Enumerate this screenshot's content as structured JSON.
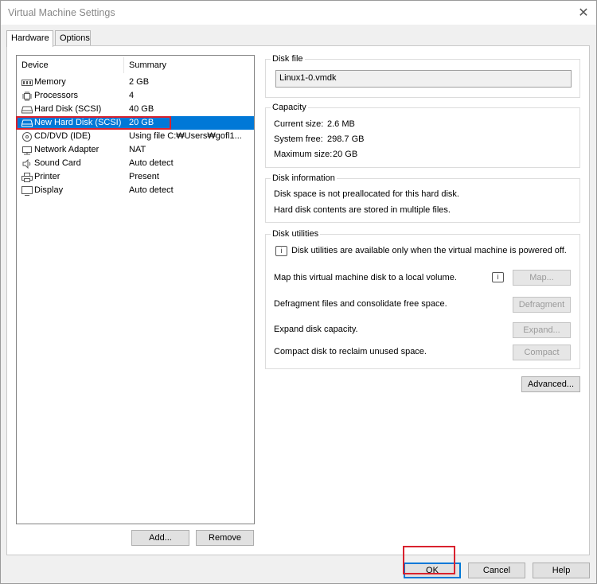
{
  "window": {
    "title": "Virtual Machine Settings",
    "close_glyph": "✕"
  },
  "tabs": [
    {
      "label": "Hardware"
    },
    {
      "label": "Options"
    }
  ],
  "device_list": {
    "col_device": "Device",
    "col_summary": "Summary",
    "rows": [
      {
        "icon": "memory-icon",
        "name": "Memory",
        "summary": "2 GB"
      },
      {
        "icon": "processor-icon",
        "name": "Processors",
        "summary": "4"
      },
      {
        "icon": "hard-disk-icon",
        "name": "Hard Disk (SCSI)",
        "summary": "40 GB"
      },
      {
        "icon": "hard-disk-icon",
        "name": "New Hard Disk (SCSI)",
        "summary": "20 GB",
        "selected": true
      },
      {
        "icon": "cd-dvd-icon",
        "name": "CD/DVD (IDE)",
        "summary": "Using file C:₩Users₩gofl1..."
      },
      {
        "icon": "network-icon",
        "name": "Network Adapter",
        "summary": "NAT"
      },
      {
        "icon": "sound-icon",
        "name": "Sound Card",
        "summary": "Auto detect"
      },
      {
        "icon": "printer-icon",
        "name": "Printer",
        "summary": "Present"
      },
      {
        "icon": "display-icon",
        "name": "Display",
        "summary": "Auto detect"
      }
    ],
    "add_label": "Add...",
    "remove_label": "Remove"
  },
  "disk_file": {
    "label": "Disk file",
    "value": "Linux1-0.vmdk"
  },
  "capacity": {
    "label": "Capacity",
    "current_label": "Current size:",
    "current_value": "2.6 MB",
    "free_label": "System free:",
    "free_value": "298.7 GB",
    "max_label": "Maximum size:",
    "max_value": "20 GB"
  },
  "disk_information": {
    "label": "Disk information",
    "line1": "Disk space is not preallocated for this hard disk.",
    "line2": "Hard disk contents are stored in multiple files."
  },
  "disk_utilities": {
    "label": "Disk utilities",
    "notice": "Disk utilities are available only when the virtual machine is powered off.",
    "map_text": "Map this virtual machine disk to a local volume.",
    "map_button": "Map...",
    "defrag_text": "Defragment files and consolidate free space.",
    "defrag_button": "Defragment",
    "expand_text": "Expand disk capacity.",
    "expand_button": "Expand...",
    "compact_text": "Compact disk to reclaim unused space.",
    "compact_button": "Compact"
  },
  "advanced_label": "Advanced...",
  "footer": {
    "ok_label": "OK",
    "cancel_label": "Cancel",
    "help_label": "Help"
  },
  "colors": {
    "selection": "#0078d7",
    "highlight": "#d9222e"
  }
}
